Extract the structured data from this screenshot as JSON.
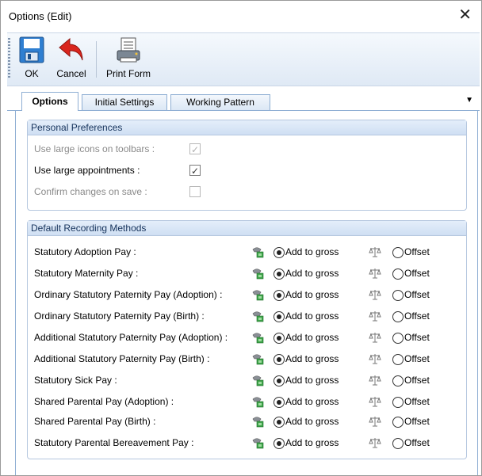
{
  "window": {
    "title": "Options (Edit)",
    "close_glyph": "✕"
  },
  "toolbar": {
    "ok_label": "OK",
    "cancel_label": "Cancel",
    "print_label": "Print Form"
  },
  "tabs": [
    {
      "label": "Options",
      "active": true
    },
    {
      "label": "Initial Settings",
      "active": false
    },
    {
      "label": "Working Pattern",
      "active": false
    }
  ],
  "tab_menu_glyph": "▼",
  "personal_preferences": {
    "header": "Personal Preferences",
    "items": [
      {
        "label": "Use large icons on toolbars :",
        "checked": true,
        "enabled": false
      },
      {
        "label": "Use large appointments :",
        "checked": true,
        "enabled": true
      },
      {
        "label": "Confirm changes on save :",
        "checked": false,
        "enabled": false
      }
    ]
  },
  "default_recording": {
    "header": "Default Recording Methods",
    "option1_label": "Add to gross",
    "option2_label": "Offset",
    "rows": [
      {
        "label": "Statutory Adoption Pay :",
        "selected": "Add to gross"
      },
      {
        "label": "Statutory Maternity Pay :",
        "selected": "Add to gross"
      },
      {
        "label": "Ordinary Statutory Paternity Pay (Adoption) :",
        "selected": "Add to gross"
      },
      {
        "label": "Ordinary Statutory Paternity Pay (Birth) :",
        "selected": "Add to gross"
      },
      {
        "label": "Additional Statutory Paternity Pay (Adoption) :",
        "selected": "Add to gross"
      },
      {
        "label": "Additional Statutory Paternity Pay (Birth) :",
        "selected": "Add to gross"
      },
      {
        "label": "Statutory Sick Pay :",
        "selected": "Add to gross"
      },
      {
        "label": "Shared Parental Pay (Adoption) :",
        "selected": "Add to gross"
      },
      {
        "label": "Shared Parental Pay (Birth) :",
        "selected": "Add to gross"
      },
      {
        "label": "Statutory Parental Bereavement Pay :",
        "selected": "Add to gross"
      }
    ]
  },
  "colors": {
    "accent": "#8eaed3",
    "group_header": "#cfdff3",
    "cancel_arrow": "#d9251d",
    "save_blue": "#2f7fd1"
  }
}
